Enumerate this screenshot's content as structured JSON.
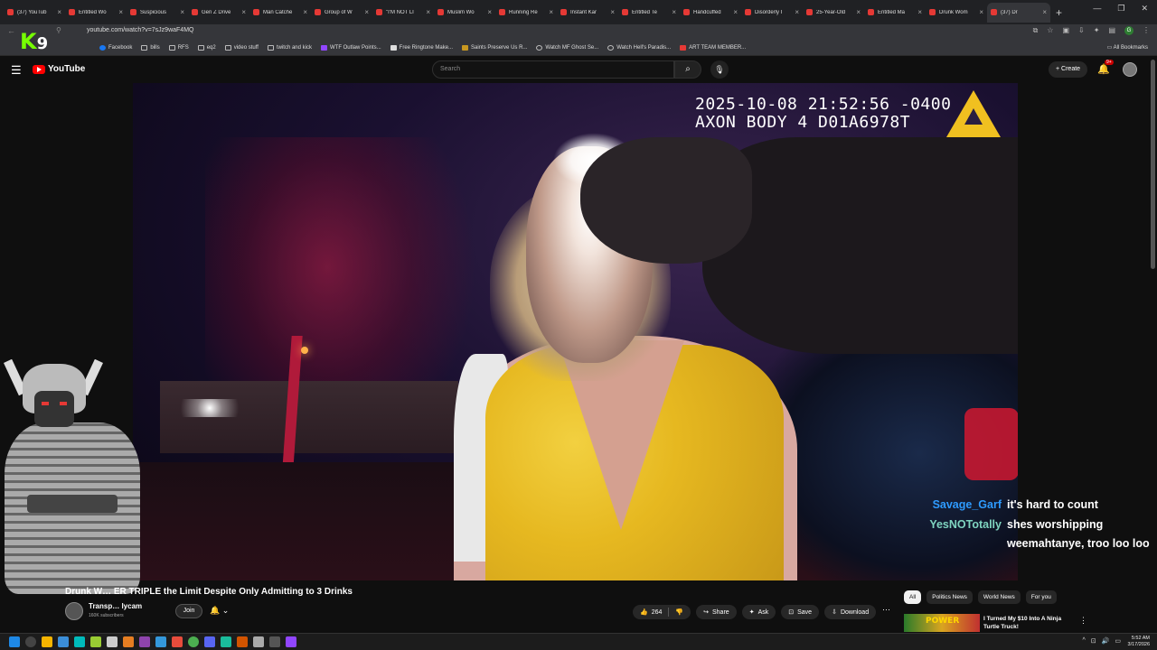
{
  "browser": {
    "tabs": [
      "(37) YouTub",
      "Entitled Wo",
      "Suspicious",
      "Gen Z Drive",
      "Man Catche",
      "Group of W",
      "\"I'M NOT LI",
      "Muslim Wo",
      "Running Re",
      "Instant Kar",
      "Entitled Te",
      "Handcuffed",
      "Disorderly I",
      "25-Year-Old",
      "Entitled Ma",
      "Drunk Wom",
      "(37) Dr"
    ],
    "url": "youtube.com/watch?v=7sJz9waF4MQ",
    "bookmarks": [
      "Facebook",
      "bills",
      "RFS",
      "eq2",
      "video stuff",
      "twitch and kick",
      "WTF Outlaw Points...",
      "Free Ringtone Make...",
      "Saints Preserve Us R...",
      "Watch MF Ghost Se...",
      "Watch Hell's Paradis...",
      "ART TEAM MEMBER..."
    ],
    "all_bookmarks": "All Bookmarks",
    "profile_initial": "G"
  },
  "overlay_badge": {
    "letter": "K",
    "number": "9"
  },
  "youtube": {
    "logo": "YouTube",
    "search_placeholder": "Search",
    "create_label": "Create",
    "notif_count": "9+"
  },
  "video": {
    "stamp_line1": "2025-10-08 21:52:56 -0400",
    "stamp_line2": "AXON BODY 4 D01A6978T",
    "title": "Drunk W…        ER TRIPLE the Limit Despite Only Admitting to 3 Drinks",
    "channel": "Transp…     lycam",
    "subscribers": "160K subscribers",
    "join_label": "Join",
    "like_count": "264",
    "share_label": "Share",
    "ask_label": "Ask",
    "save_label": "Save",
    "download_label": "Download"
  },
  "chat": [
    {
      "user": "Savage_Garf",
      "msg": "it's hard to count"
    },
    {
      "user": "YesNOTotally",
      "msg": "shes worshipping weemahtanye, troo loo loo"
    }
  ],
  "chips": [
    "All",
    "Politics News",
    "World News",
    "For you"
  ],
  "recommendation": {
    "thumb_text": "POWER",
    "title": "I Turned My $10 Into A Ninja Turtle Truck!"
  },
  "taskbar": {
    "time": "5:52 AM",
    "date": "3/17/2026"
  },
  "colors": {
    "chat_user1": "#2e9bff",
    "chat_user2": "#7fd4c0",
    "youtube_red": "#ff0000",
    "axon_yellow": "#f0c020"
  }
}
